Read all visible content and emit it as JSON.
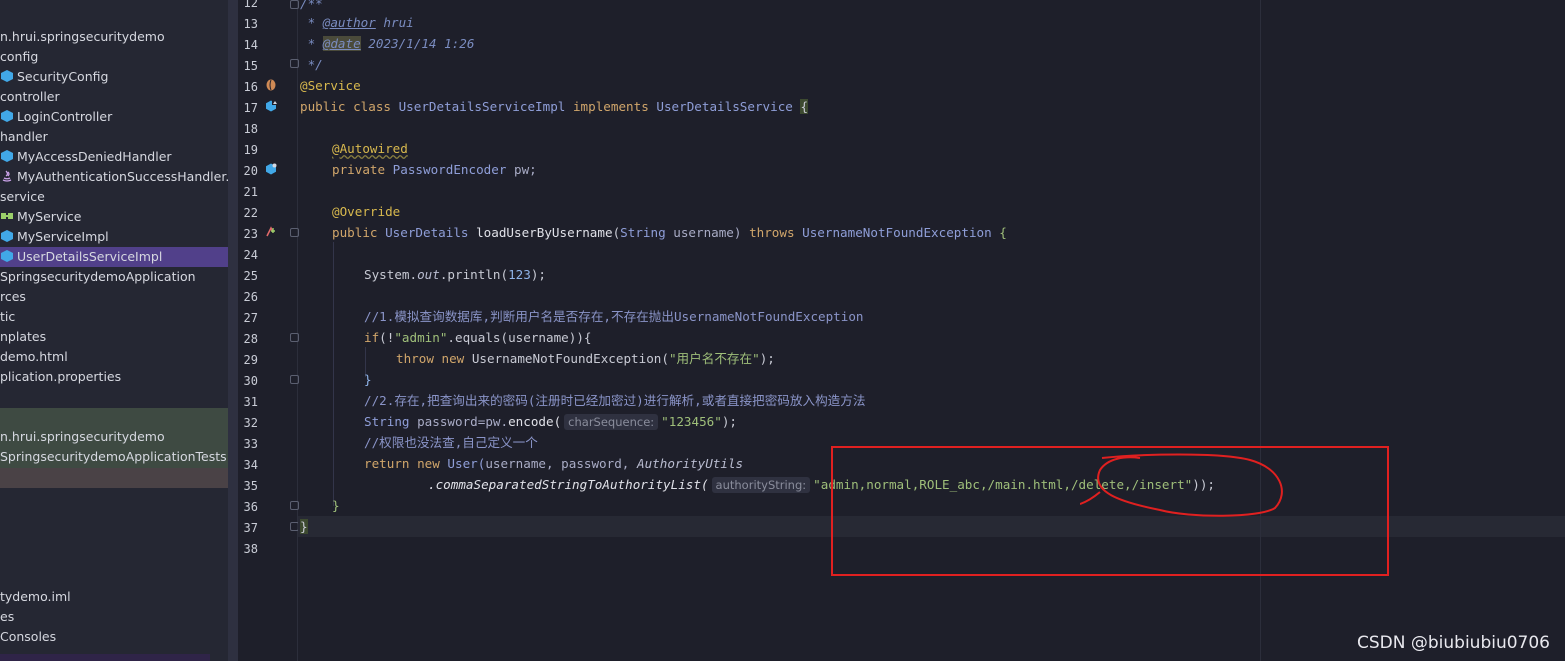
{
  "sidebar": {
    "items": [
      {
        "label": "n.hrui.springsecuritydemo",
        "icon": "none"
      },
      {
        "label": "config",
        "icon": "none"
      },
      {
        "label": "SecurityConfig",
        "icon": "class-icon"
      },
      {
        "label": "controller",
        "icon": "none"
      },
      {
        "label": "LoginController",
        "icon": "class-icon"
      },
      {
        "label": "handler",
        "icon": "none"
      },
      {
        "label": "MyAccessDeniedHandler",
        "icon": "class-icon"
      },
      {
        "label": "MyAuthenticationSuccessHandler.jav",
        "icon": "java-icon"
      },
      {
        "label": "service",
        "icon": "none"
      },
      {
        "label": "MyService",
        "icon": "interface-icon"
      },
      {
        "label": "MyServiceImpl",
        "icon": "class-icon"
      },
      {
        "label": "UserDetailsServiceImpl",
        "icon": "class-icon"
      },
      {
        "label": "SpringsecuritydemoApplication",
        "icon": "none"
      },
      {
        "label": "rces",
        "icon": "none"
      },
      {
        "label": "tic",
        "icon": "none"
      },
      {
        "label": "nplates",
        "icon": "none"
      },
      {
        "label": "demo.html",
        "icon": "none"
      },
      {
        "label": "plication.properties",
        "icon": "none"
      },
      {
        "label": "n.hrui.springsecuritydemo",
        "icon": "none"
      },
      {
        "label": "SpringsecuritydemoApplicationTests",
        "icon": "none"
      },
      {
        "label": "tydemo.iml",
        "icon": "none"
      },
      {
        "label": "es",
        "icon": "none"
      },
      {
        "label": "Consoles",
        "icon": "none"
      }
    ],
    "selected": "UserDetailsServiceImpl"
  },
  "editor": {
    "line_numbers": [
      "12",
      "13",
      "14",
      "15",
      "16",
      "17",
      "18",
      "19",
      "20",
      "21",
      "22",
      "23",
      "24",
      "25",
      "26",
      "27",
      "28",
      "29",
      "30",
      "31",
      "32",
      "33",
      "34",
      "35",
      "36",
      "37",
      "38"
    ],
    "code": {
      "l12": "/**",
      "l13_prefix": " * ",
      "l13_tag": "@author",
      "l13_rest": " hrui",
      "l14_prefix": " * ",
      "l14_tag": "@date",
      "l14_rest": " 2023/1/14 1:26",
      "l15": " */",
      "l16": "@Service",
      "l17_kw": "public class ",
      "l17_name": "UserDetailsServiceImpl ",
      "l17_impl": "implements ",
      "l17_iface": "UserDetailsService ",
      "l17_brace": "{",
      "l19": "@Autowired",
      "l20_kw": "private ",
      "l20_type": "PasswordEncoder ",
      "l20_var": "pw;",
      "l22": "@Override",
      "l23_kw": "public ",
      "l23_type": "UserDetails ",
      "l23_meth": "loadUserByUsername",
      "l23_open": "(",
      "l23_ptype": "String ",
      "l23_pname": "username) ",
      "l23_throws": "throws ",
      "l23_exc": "UsernameNotFoundException ",
      "l23_brace": "{",
      "l25_a": "System.",
      "l25_out": "out",
      "l25_b": ".println(",
      "l25_num": "123",
      "l25_c": ");",
      "l27": "//1.模拟查询数据库,判断用户名是否存在,不存在抛出UsernameNotFoundException",
      "l28_kw": "if",
      "l28_a": "(!",
      "l28_str": "\"admin\"",
      "l28_b": ".equals(username)){",
      "l29_kw": "throw new ",
      "l29_exc": "UsernameNotFoundException(",
      "l29_str": "\"用户名不存在\"",
      "l29_end": ");",
      "l30": "}",
      "l31": "//2.存在,把查询出来的密码(注册时已经加密过)进行解析,或者直接把密码放入构造方法",
      "l32_type": "String ",
      "l32_a": "password=pw.",
      "l32_meth": "encode(",
      "l32_hint": "charSequence:",
      "l32_str": "\"123456\"",
      "l32_end": ");",
      "l33": "//权限也没法查,自己定义一个",
      "l34_kw": "return new ",
      "l34_cls": "User(",
      "l34_a": "username, password, ",
      "l34_util": "AuthorityUtils",
      "l35_meth": ".commaSeparatedStringToAuthorityList(",
      "l35_hint": "authorityString:",
      "l35_str": "\"admin,normal,ROLE_abc,/main.html,/delete,/insert\"",
      "l35_end": "));",
      "l36": "}",
      "l37": "}"
    }
  },
  "watermark": "CSDN @biubiubiu0706",
  "colors": {
    "annotation_red": "#e02020",
    "selection": "#51408a"
  }
}
